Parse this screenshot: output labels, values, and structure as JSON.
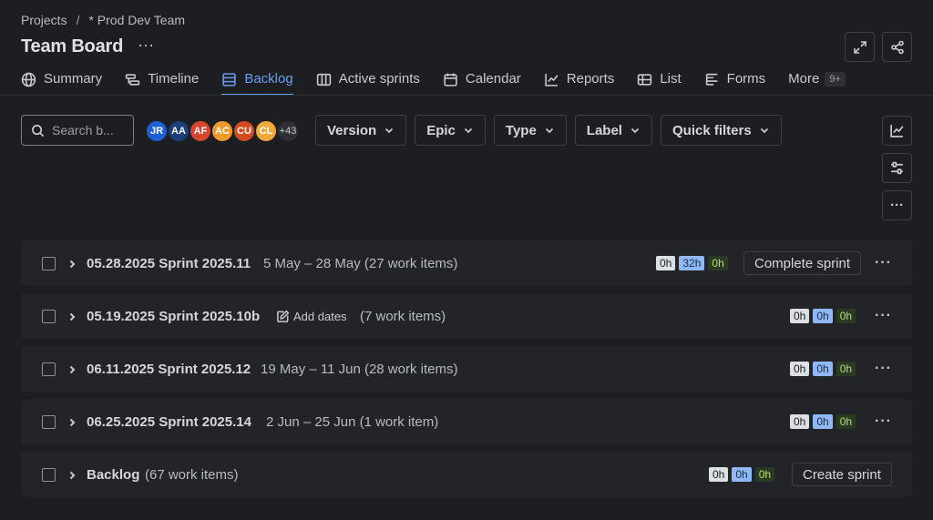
{
  "breadcrumb": {
    "root": "Projects",
    "sep": "/",
    "project": "* Prod Dev Team"
  },
  "page": {
    "title": "Team Board",
    "more": "···"
  },
  "tabs": [
    {
      "label": "Summary",
      "icon": "globe-icon"
    },
    {
      "label": "Timeline",
      "icon": "timeline-icon"
    },
    {
      "label": "Backlog",
      "icon": "backlog-icon",
      "active": true
    },
    {
      "label": "Active sprints",
      "icon": "board-icon"
    },
    {
      "label": "Calendar",
      "icon": "calendar-icon"
    },
    {
      "label": "Reports",
      "icon": "chart-icon"
    },
    {
      "label": "List",
      "icon": "list-icon"
    },
    {
      "label": "Forms",
      "icon": "form-icon"
    },
    {
      "label": "More",
      "badge": "9+"
    }
  ],
  "search": {
    "placeholder": "Search b..."
  },
  "avatars": [
    {
      "initials": "JR",
      "color": "#1f5fd6"
    },
    {
      "initials": "AA",
      "color": "#1c3f7a"
    },
    {
      "initials": "AF",
      "color": "#d6452f"
    },
    {
      "initials": "AC",
      "color": "#f09a2c"
    },
    {
      "initials": "CU",
      "color": "#d24b1f"
    },
    {
      "initials": "CL",
      "color": "#f0a93b"
    },
    {
      "initials": "+43",
      "color": "#2e3035"
    }
  ],
  "filters": [
    "Version",
    "Epic",
    "Type",
    "Label",
    "Quick filters"
  ],
  "sprints": [
    {
      "name": "05.28.2025 Sprint 2025.11",
      "info": "5 May – 28 May (27 work items)",
      "pills": [
        "0h",
        "32h",
        "0h"
      ],
      "action": "Complete sprint"
    },
    {
      "name": "05.19.2025 Sprint 2025.10b",
      "add_dates": "Add dates",
      "info": "(7 work items)",
      "pills": [
        "0h",
        "0h",
        "0h"
      ]
    },
    {
      "name": "06.11.2025 Sprint 2025.12",
      "info": "19 May – 11 Jun (28 work items)",
      "pills": [
        "0h",
        "0h",
        "0h"
      ]
    },
    {
      "name": "06.25.2025 Sprint 2025.14",
      "info": "2 Jun – 25 Jun (1 work item)",
      "pills": [
        "0h",
        "0h",
        "0h"
      ]
    },
    {
      "name": "Backlog",
      "info": "(67 work items)",
      "pills": [
        "0h",
        "0h",
        "0h"
      ],
      "action": "Create sprint"
    }
  ],
  "row_more": "···"
}
